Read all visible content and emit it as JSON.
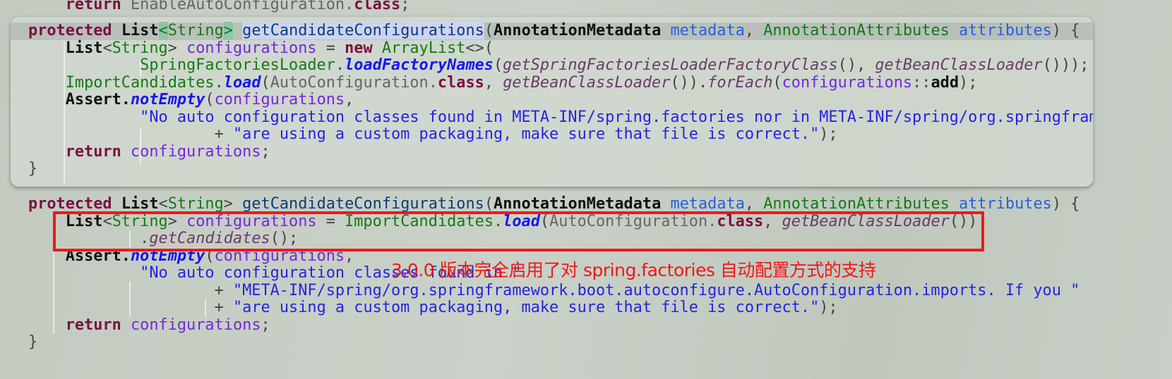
{
  "top_line": [
    [
      "    ",
      "pl"
    ],
    [
      "return",
      "kw"
    ],
    [
      " EnableAutoConfiguration.",
      "gr"
    ],
    [
      "class",
      "kw"
    ],
    [
      ";",
      "pl"
    ]
  ],
  "popup_lines": [
    [
      [
        "protected",
        "kw"
      ],
      [
        " ",
        "pl"
      ],
      [
        "List",
        "ty"
      ],
      [
        "<",
        "gnh"
      ],
      [
        "String",
        "gn"
      ],
      [
        ">",
        "gnh"
      ],
      [
        " ",
        "pl"
      ],
      [
        "getCandidateConfigurations",
        "fnh"
      ],
      [
        "(",
        "pl"
      ],
      [
        "AnnotationMetadata",
        "ty"
      ],
      [
        " ",
        "pl"
      ],
      [
        "metadata",
        "pa"
      ],
      [
        ", ",
        "pl"
      ],
      [
        "AnnotationAttributes",
        "cl"
      ],
      [
        " ",
        "pl"
      ],
      [
        "attributes",
        "pa"
      ],
      [
        ") {",
        "pl"
      ]
    ],
    [
      [
        "    ",
        "pl"
      ],
      [
        "List",
        "ty"
      ],
      [
        "<",
        "pl"
      ],
      [
        "String",
        "gn"
      ],
      [
        "> ",
        "pl"
      ],
      [
        "configurations",
        "va"
      ],
      [
        " = ",
        "pl"
      ],
      [
        "new",
        "kw"
      ],
      [
        " ",
        "pl"
      ],
      [
        "ArrayList",
        "cl"
      ],
      [
        "<>(",
        "pl"
      ]
    ],
    [
      [
        "            ",
        "pl"
      ],
      [
        "SpringFactoriesLoader",
        "cl"
      ],
      [
        ".",
        "pl"
      ],
      [
        "loadFactoryNames",
        "mi"
      ],
      [
        "(",
        "pl"
      ],
      [
        "getSpringFactoriesLoaderFactoryClass",
        "it"
      ],
      [
        "(), ",
        "pl"
      ],
      [
        "getBeanClassLoader",
        "it"
      ],
      [
        "()));",
        "pl"
      ]
    ],
    [
      [
        "    ",
        "pl"
      ],
      [
        "ImportCandidates",
        "cl"
      ],
      [
        ".",
        "pl"
      ],
      [
        "load",
        "mi"
      ],
      [
        "(",
        "pl"
      ],
      [
        "AutoConfiguration.",
        "gr"
      ],
      [
        "class",
        "kw"
      ],
      [
        ", ",
        "pl"
      ],
      [
        "getBeanClassLoader",
        "it"
      ],
      [
        "()).",
        "pl"
      ],
      [
        "forEach",
        "it"
      ],
      [
        "(",
        "pl"
      ],
      [
        "configurations",
        "va"
      ],
      [
        "::",
        "pl"
      ],
      [
        "add",
        "ty"
      ],
      [
        ");",
        "pl"
      ]
    ],
    [
      [
        "    ",
        "pl"
      ],
      [
        "Assert.",
        "ty"
      ],
      [
        "notEmpty",
        "mi"
      ],
      [
        "(",
        "pl"
      ],
      [
        "configurations",
        "va"
      ],
      [
        ",",
        "pl"
      ]
    ],
    [
      [
        "            ",
        "pl"
      ],
      [
        "\"No auto configuration classes found in META-INF/spring.factories nor in META-INF/spring/org.springfram",
        "st"
      ]
    ],
    [
      [
        "                    + ",
        "pl"
      ],
      [
        "\"are using a custom packaging, make sure that file is correct.\"",
        "st"
      ],
      [
        ");",
        "pl"
      ]
    ],
    [
      [
        "    ",
        "pl"
      ],
      [
        "return",
        "kw"
      ],
      [
        " ",
        "pl"
      ],
      [
        "configurations",
        "va"
      ],
      [
        ";",
        "pl"
      ]
    ],
    [
      [
        "}",
        "pl"
      ]
    ]
  ],
  "main_lines": [
    [
      [
        "protected",
        "kw"
      ],
      [
        " ",
        "pl"
      ],
      [
        "List",
        "ty"
      ],
      [
        "<",
        "pl"
      ],
      [
        "String",
        "gn"
      ],
      [
        "> ",
        "pl"
      ],
      [
        "getCandidateConfigurations",
        "fn"
      ],
      [
        "(",
        "pl"
      ],
      [
        "AnnotationMetadata",
        "ty"
      ],
      [
        " ",
        "pl"
      ],
      [
        "metadata",
        "pa"
      ],
      [
        ", ",
        "pl"
      ],
      [
        "AnnotationAttributes",
        "cl"
      ],
      [
        " ",
        "pl"
      ],
      [
        "attributes",
        "pa"
      ],
      [
        ") {",
        "pl"
      ]
    ],
    [
      [
        "    ",
        "pl"
      ],
      [
        "List",
        "ty"
      ],
      [
        "<",
        "pl"
      ],
      [
        "String",
        "gn"
      ],
      [
        "> ",
        "pl"
      ],
      [
        "configurations",
        "va"
      ],
      [
        " = ",
        "pl"
      ],
      [
        "ImportCandidates",
        "cl"
      ],
      [
        ".",
        "pl"
      ],
      [
        "load",
        "mi"
      ],
      [
        "(",
        "pl"
      ],
      [
        "AutoConfiguration.",
        "gr"
      ],
      [
        "class",
        "kw"
      ],
      [
        ", ",
        "pl"
      ],
      [
        "getBeanClassLoader",
        "it"
      ],
      [
        "())",
        "pl"
      ]
    ],
    [
      [
        "            .",
        "pl"
      ],
      [
        "getCandidates",
        "it"
      ],
      [
        "();",
        "pl"
      ]
    ],
    [
      [
        "    ",
        "pl"
      ],
      [
        "Assert.",
        "ty"
      ],
      [
        "notEmpty",
        "mi"
      ],
      [
        "(",
        "pl"
      ],
      [
        "configurations",
        "va"
      ],
      [
        ",",
        "pl"
      ]
    ],
    [
      [
        "            ",
        "pl"
      ],
      [
        "\"No auto configuration classes found in \"",
        "st"
      ]
    ],
    [
      [
        "                    + ",
        "pl"
      ],
      [
        "\"META-INF/spring/org.springframework.boot.autoconfigure.AutoConfiguration.imports. If you \"",
        "st"
      ]
    ],
    [
      [
        "                    + ",
        "pl"
      ],
      [
        "\"are using a custom packaging, make sure that file is correct.\"",
        "st"
      ],
      [
        ");",
        "pl"
      ]
    ],
    [
      [
        "    ",
        "pl"
      ],
      [
        "return",
        "kw"
      ],
      [
        " ",
        "pl"
      ],
      [
        "configurations",
        "va"
      ],
      [
        ";",
        "pl"
      ]
    ],
    [
      [
        "}",
        "pl"
      ]
    ]
  ],
  "annotation": {
    "text": "3.0.0 版本完全启用了对 spring.factories 自动配置方式的支持",
    "color": "#f01818"
  }
}
